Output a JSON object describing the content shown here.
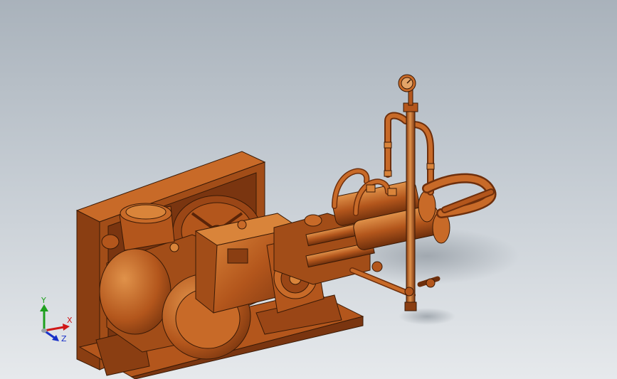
{
  "viewport": {
    "background_top": "#a9b2bb",
    "background_bottom": "#e6e9ec"
  },
  "model": {
    "body_color": "#b3561c",
    "shade_color": "#7a3510",
    "highlight_color": "#d9843a",
    "edge_color": "#3a1a06"
  },
  "triad": {
    "y_label": "Y",
    "x_label": "X",
    "z_label": "Z",
    "y_color": "#1fa01f",
    "x_color": "#d01818",
    "z_color": "#1830c8"
  }
}
